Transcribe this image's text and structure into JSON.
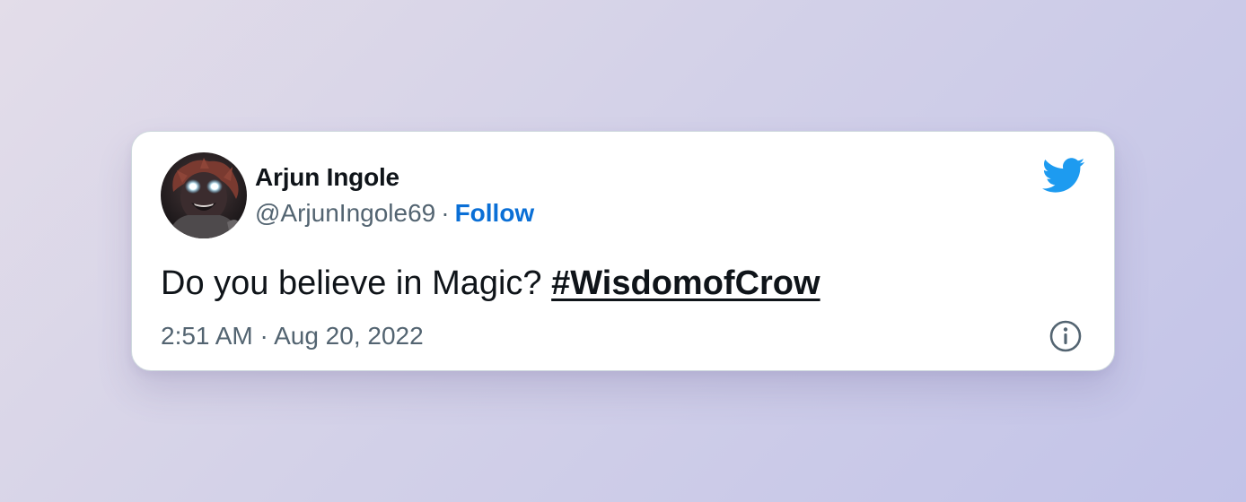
{
  "author": {
    "name": "Arjun Ingole",
    "handle": "@ArjunIngole69",
    "separator": "·",
    "follow_label": "Follow"
  },
  "tweet": {
    "text_plain": "Do you believe in Magic? ",
    "hashtag": "#WisdomofCrow"
  },
  "meta": {
    "time": "2:51 AM",
    "separator": "·",
    "date": "Aug 20, 2022"
  },
  "icons": {
    "brand": "twitter-bird-icon",
    "info": "info-icon"
  },
  "colors": {
    "follow": "#0a6fd6",
    "twitter_blue": "#1d9bf0",
    "text_primary": "#0f1419",
    "text_secondary": "#536471"
  }
}
